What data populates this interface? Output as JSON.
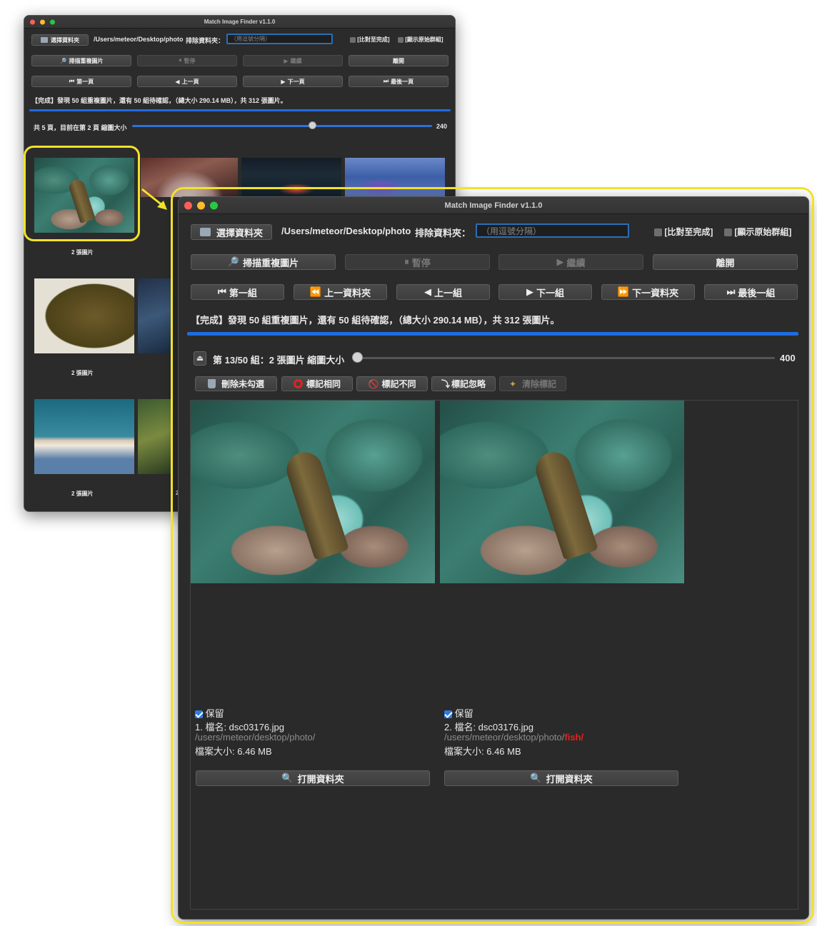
{
  "back_window": {
    "title": "Match Image Finder v1.1.0",
    "select_folder": "選擇資料夾",
    "path": "/Users/meteor/Desktop/photo",
    "exclude_label": "排除資料夾：",
    "exclude_placeholder": "（用逗號分隔）",
    "compare_done": "[比對至完成]",
    "show_original": "[顯示原始群組]",
    "scan": "掃描重複圖片",
    "pause": "暫停",
    "resume": "繼續",
    "quit": "離開",
    "first_page": "第一頁",
    "prev_page": "上一頁",
    "next_page": "下一頁",
    "last_page": "最後一頁",
    "status": "【完成】發現 50 組重複圖片，還有 50 組待確認，（總大小 290.14 MB），共 312 張圖片。",
    "page_info": "共 5 頁，目前在第 2 頁  縮圖大小",
    "thumb_size": "240",
    "thumb_caption_1": "2 張圖片",
    "thumb_caption_2": "2 張圖片",
    "thumb_caption_3": "2 張圖片",
    "caption_partial": "2"
  },
  "front_window": {
    "title": "Match Image Finder v1.1.0",
    "select_folder": "選擇資料夾",
    "path": "/Users/meteor/Desktop/photo",
    "exclude_label": "排除資料夾：",
    "exclude_placeholder": "（用逗號分隔）",
    "compare_done": "[比對至完成]",
    "show_original": "[顯示原始群組]",
    "scan": "掃描重複圖片",
    "pause": "暫停",
    "resume": "繼續",
    "quit": "離開",
    "first_group": "第一組",
    "prev_folder": "上一資料夾",
    "prev_group": "上一組",
    "next_group": "下一組",
    "next_folder": "下一資料夾",
    "last_group": "最後一組",
    "status": "【完成】發現 50 組重複圖片，還有 50 組待確認，（總大小 290.14 MB），共 312 張圖片。",
    "group_info": "第 13/50 組：2 張圖片  縮圖大小",
    "thumb_size": "400",
    "delete_unchecked": "刪除未勾選",
    "mark_same": "標記相同",
    "mark_different": "標記不同",
    "mark_ignore": "標記忽略",
    "clear_marks": "清除標記",
    "items": [
      {
        "keep": "保留",
        "filename": "1. 檔名: dsc03176.jpg",
        "path": "/users/meteor/desktop/photo/",
        "path_highlight": "",
        "size": "檔案大小: 6.46 MB",
        "open_folder": "打開資料夾"
      },
      {
        "keep": "保留",
        "filename": "2. 檔名: dsc03176.jpg",
        "path": "/users/meteor/desktop/photo/",
        "path_highlight": "fish/",
        "size": "檔案大小: 6.46 MB",
        "open_folder": "打開資料夾"
      }
    ]
  },
  "colors": {
    "callout": "#f2e22b",
    "accent": "#1f6de0",
    "highlight_red": "#e0241e"
  }
}
